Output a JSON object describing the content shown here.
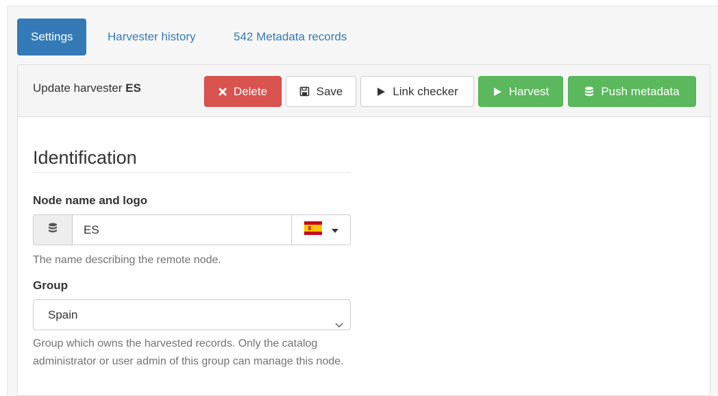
{
  "tabs": [
    {
      "label": "Settings",
      "active": true
    },
    {
      "label": "Harvester history",
      "active": false
    },
    {
      "label": "542 Metadata records",
      "active": false
    }
  ],
  "header": {
    "title_prefix": "Update harvester",
    "title_name": "ES"
  },
  "toolbar": {
    "delete_label": "Delete",
    "save_label": "Save",
    "link_checker_label": "Link checker",
    "harvest_label": "Harvest",
    "push_metadata_label": "Push metadata"
  },
  "identification": {
    "section_title": "Identification",
    "node_name_label": "Node name and logo",
    "node_name_value": "ES",
    "node_name_help": "The name describing the remote node.",
    "logo_icon": "spain-flag-icon",
    "group_label": "Group",
    "group_selected": "Spain",
    "group_help": "Group which owns the harvested records. Only the catalog administrator or user admin of this group can manage this node."
  },
  "colors": {
    "primary": "#337ab7",
    "danger": "#d9534f",
    "success": "#5cb85c"
  }
}
